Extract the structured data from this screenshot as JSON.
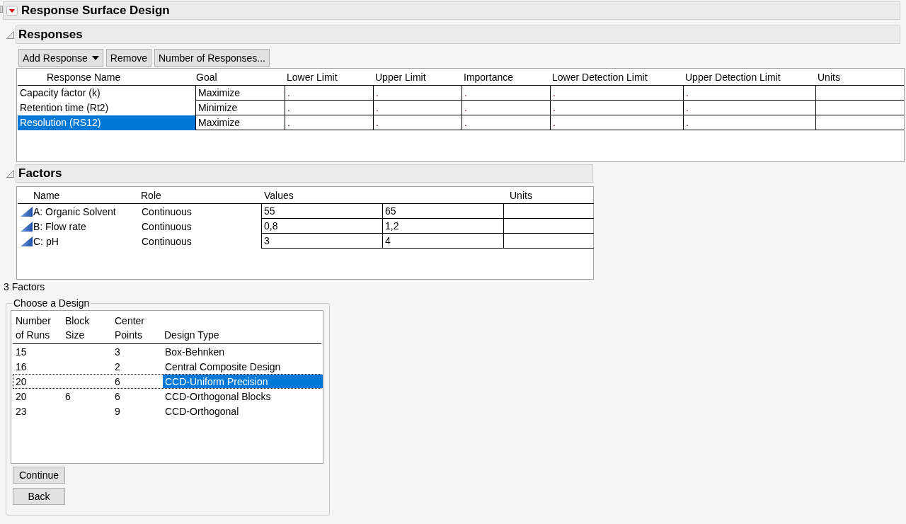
{
  "title": "Response Surface Design",
  "responses": {
    "heading": "Responses",
    "buttons": [
      {
        "label": "Add Response",
        "kind": "dropdown"
      },
      {
        "label": "Remove",
        "kind": "plain"
      },
      {
        "label": "Number of Responses...",
        "kind": "plain"
      }
    ],
    "columns": [
      "Response Name",
      "Goal",
      "Lower Limit",
      "Upper Limit",
      "Importance",
      "Lower Detection Limit",
      "Upper Detection Limit",
      "Units"
    ],
    "rows": [
      {
        "name": "Capacity factor (k)",
        "goal": "Maximize",
        "limits": [
          ".",
          ".",
          ".",
          ".",
          "."
        ],
        "selected": false
      },
      {
        "name": "Retention time (Rt2)",
        "goal": "Minimize",
        "limits": [
          ".",
          ".",
          ".",
          ".",
          "."
        ],
        "selected": false
      },
      {
        "name": "Resolution (RS12)",
        "goal": "Maximize",
        "limits": [
          ".",
          ".",
          ".",
          ".",
          "."
        ],
        "selected": true
      }
    ]
  },
  "factors": {
    "heading": "Factors",
    "columns": [
      "Name",
      "Role",
      "Values",
      "Units"
    ],
    "rows": [
      {
        "name": "A: Organic Solvent",
        "role": "Continuous",
        "values": [
          "55",
          "65"
        ]
      },
      {
        "name": "B: Flow rate",
        "role": "Continuous",
        "values": [
          "0,8",
          "1,2"
        ]
      },
      {
        "name": "C: pH",
        "role": "Continuous",
        "values": [
          "3",
          "4"
        ]
      }
    ]
  },
  "factor_count": "3 Factors",
  "design_chooser": {
    "legend": "Choose a Design",
    "columns": [
      "Number\nof Runs",
      "Block\nSize",
      "Center\nPoints",
      "Design Type"
    ],
    "rows": [
      {
        "runs": "15",
        "center_points": "3",
        "design_type": "Box-Behnken",
        "selected": false
      },
      {
        "runs": "16",
        "center_points": "2",
        "design_type": "Central Composite Design",
        "selected": false
      },
      {
        "runs": "20",
        "center_points": "6",
        "design_type": "CCD-Uniform Precision",
        "selected": true
      },
      {
        "runs": "20",
        "block_size": "6",
        "center_points": "6",
        "design_type": "CCD-Orthogonal Blocks",
        "selected": false
      },
      {
        "runs": "23",
        "center_points": "9",
        "design_type": "CCD-Orthogonal",
        "selected": false
      }
    ],
    "buttons": [
      "Continue",
      "Back"
    ]
  }
}
